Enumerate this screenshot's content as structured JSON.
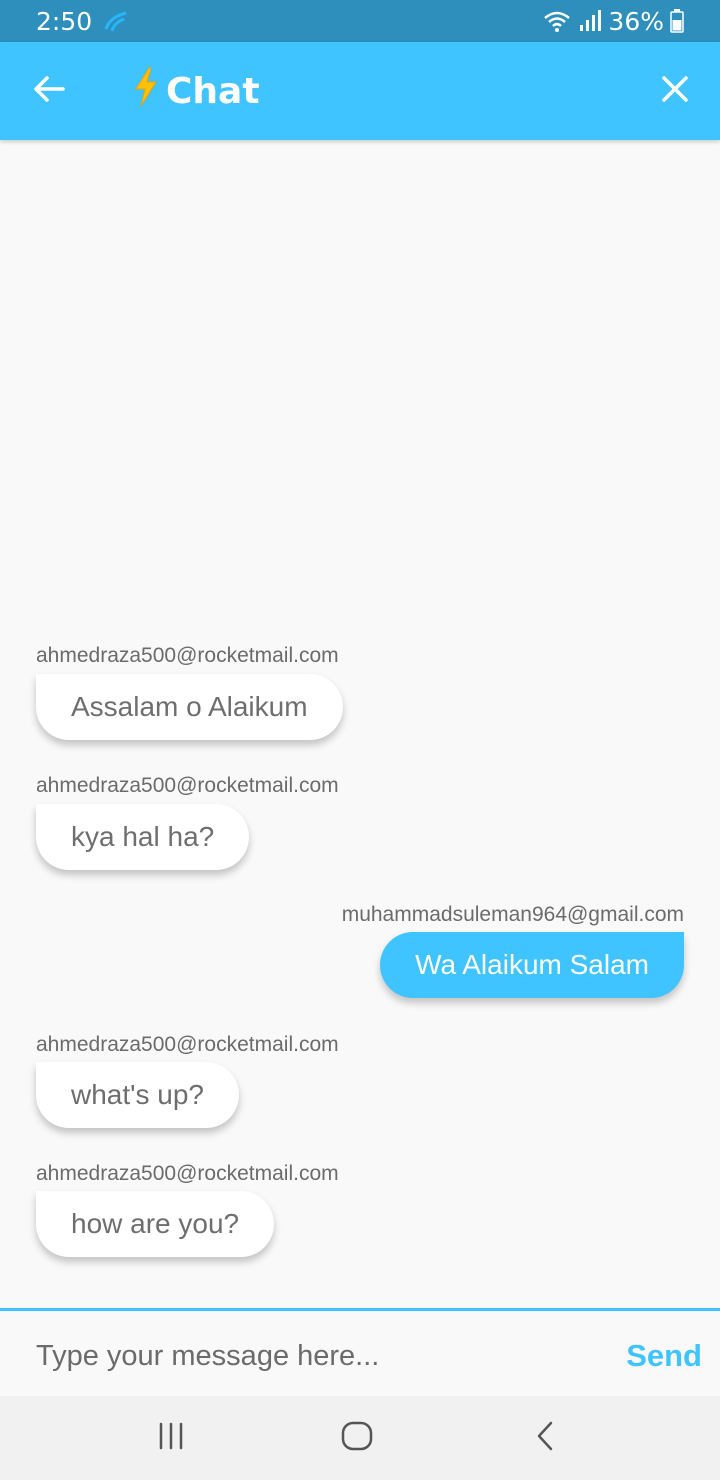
{
  "status_bar": {
    "time": "2:50",
    "battery": "36%"
  },
  "app_bar": {
    "title": "Chat",
    "title_icon": "lightning-icon",
    "back_icon": "back-arrow-icon",
    "close_icon": "close-icon",
    "color": "#40c4ff"
  },
  "messages": [
    {
      "sender": "ahmedraza500@rocketmail.com",
      "text": "Assalam o Alaikum",
      "direction": "received"
    },
    {
      "sender": "ahmedraza500@rocketmail.com",
      "text": "kya hal ha?",
      "direction": "received"
    },
    {
      "sender": "muhammadsuleman964@gmail.com",
      "text": "Wa Alaikum Salam",
      "direction": "sent"
    },
    {
      "sender": "ahmedraza500@rocketmail.com",
      "text": "what's up?",
      "direction": "received"
    },
    {
      "sender": "ahmedraza500@rocketmail.com",
      "text": "how are you?",
      "direction": "received"
    }
  ],
  "composer": {
    "placeholder": "Type your message here...",
    "value": "",
    "send_label": "Send"
  },
  "nav_bar": {
    "recents_icon": "recents-icon",
    "home_icon": "home-icon",
    "back_icon": "nav-back-icon"
  }
}
